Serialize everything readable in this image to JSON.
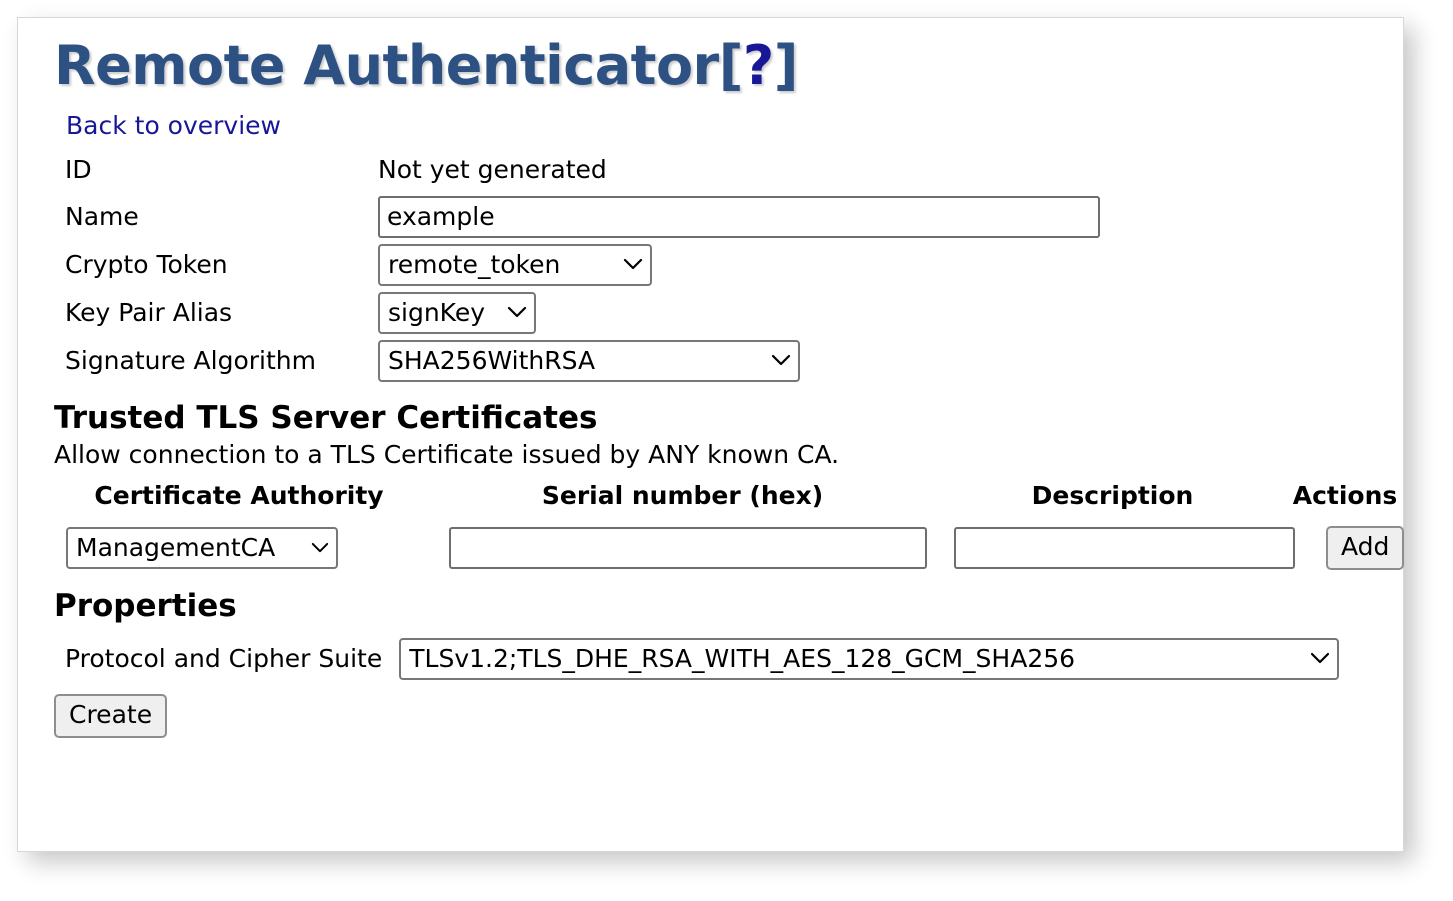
{
  "page": {
    "title_main": "Remote Authenticator",
    "title_bracket_open": "[",
    "title_help": "?",
    "title_bracket_close": "]",
    "back_link": "Back to overview"
  },
  "form": {
    "rows": [
      {
        "label": "ID",
        "value": "Not yet generated"
      },
      {
        "label": "Name",
        "value": "example"
      },
      {
        "label": "Crypto Token",
        "value": "remote_token"
      },
      {
        "label": "Key Pair Alias",
        "value": "signKey"
      },
      {
        "label": "Signature Algorithm",
        "value": "SHA256WithRSA"
      }
    ],
    "name_placeholder": "",
    "chevron_icon": "chevron-down-icon"
  },
  "certificates": {
    "section_title": "Trusted TLS Server Certificates",
    "section_desc": "Allow connection to a TLS Certificate issued by ANY known CA.",
    "headers": {
      "ca": "Certificate Authority",
      "serial": "Serial number (hex)",
      "description": "Description",
      "actions": "Actions"
    },
    "row": {
      "ca_selected": "ManagementCA",
      "serial_value": "",
      "serial_placeholder": "",
      "description_value": "",
      "description_placeholder": "",
      "add_label": "Add"
    }
  },
  "properties": {
    "section_title": "Properties",
    "protocol_label": "Protocol and Cipher Suite",
    "protocol_value": "TLSv1.2;TLS_DHE_RSA_WITH_AES_128_GCM_SHA256"
  },
  "actions": {
    "create_label": "Create"
  },
  "colors": {
    "title": "#2e5184",
    "link": "#181897",
    "text": "#000000",
    "input_border": "#6e6e6e",
    "button_bg": "#efefef",
    "card_bg": "#ffffff"
  }
}
